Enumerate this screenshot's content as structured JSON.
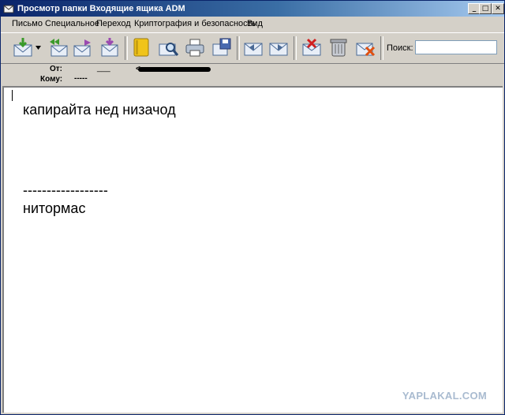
{
  "window": {
    "title": "Просмотр папки Входящие ящика ADM",
    "controls": {
      "minimize": "_",
      "maximize": "□",
      "close": "✕"
    }
  },
  "menu": {
    "items": [
      {
        "label": "Письмо"
      },
      {
        "label": "Специальное"
      },
      {
        "label": "Переход"
      },
      {
        "label": "Криптография и безопасность"
      },
      {
        "label": "Вид"
      }
    ]
  },
  "toolbar": {
    "buttons": [
      {
        "icon": "get-mail-icon"
      },
      {
        "icon": "reply-all-icon"
      },
      {
        "icon": "forward-icon"
      },
      {
        "icon": "new-message-icon"
      },
      {
        "icon": "address-book-icon"
      },
      {
        "icon": "find-icon"
      },
      {
        "icon": "print-icon"
      },
      {
        "icon": "save-icon"
      },
      {
        "icon": "previous-message-icon"
      },
      {
        "icon": "next-message-icon"
      },
      {
        "icon": "mark-spam-icon"
      },
      {
        "icon": "trash-icon"
      },
      {
        "icon": "delete-icon"
      }
    ],
    "search_label": "Поиск:",
    "search_value": ""
  },
  "header": {
    "from_label": "От:",
    "from_value": "___",
    "from_address_prefix": "<",
    "to_label": "Кому:",
    "to_value": "-----"
  },
  "message": {
    "lines": [
      "капирайта нед низачод",
      "------------------",
      "нитормас"
    ]
  },
  "watermark": "YAPLAKAL.COM"
}
